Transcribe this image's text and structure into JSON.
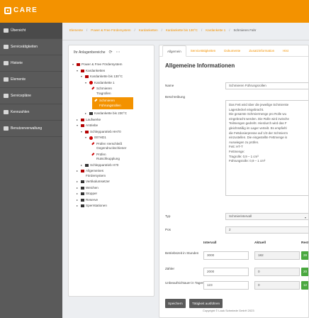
{
  "app": {
    "logo_text": "CARE"
  },
  "sidebar": {
    "items": [
      {
        "label": "Übersicht",
        "icon": "home-icon"
      },
      {
        "label": "Serviceätigkeiten",
        "icon": "wrench-icon"
      },
      {
        "label": "Historie",
        "icon": "history-icon"
      },
      {
        "label": "Elemente",
        "icon": "layers-icon"
      },
      {
        "label": "Servicepläne",
        "icon": "calendar-icon"
      },
      {
        "label": "Kennzahlen",
        "icon": "chart-icon"
      },
      {
        "label": "Benutzerverwaltung",
        "icon": "users-icon"
      }
    ]
  },
  "breadcrumb": [
    "Elemente",
    "Power & Free Fördersystem",
    "Kardanketten",
    "Kardankette bis 130°C",
    "Kardankette 1",
    "Schmieren Fahr"
  ],
  "tree": {
    "header": "Ihr Anlagenbereiche",
    "refresh_icon": "refresh-icon",
    "more_icon": "more-icon",
    "nodes": [
      "Power & Free Fördersystem",
      "Kardanketten",
      "Kardankette bis 130°C",
      "Kardankette 1",
      "Schmieren Tragrollen",
      "Schmieren Führungsrollen",
      "Kardankette bis 230°C",
      "Laufwerke",
      "Antriebe",
      "Schleppantrieb HH70",
      "007HD1",
      "Prüfen Verschleiß Gegendruckschiener",
      "Prüfen Rutschkupplung",
      "Schleppantrieb H70",
      "Allgemeines Fördersystem",
      "Vertikalumsetzer",
      "Weichen",
      "Stopper",
      "Reserve",
      "Sperrstationen"
    ]
  },
  "tabs": [
    "Allgemein",
    "Servicetätigkeiten",
    "Dokumente",
    "Zusatzinformation",
    "Hist"
  ],
  "panel": {
    "title": "Allgemeine Informationen",
    "name_label": "Name",
    "name_value": "Schmieren Führungsrollen",
    "desc_label": "Beschreibung",
    "desc_lines": [
      "Das Fett wird über die jeweilige Schmierste",
      "Lagerdeckel eingebracht.",
      "Die gesamte Schmiermenge pro Rolle wu",
      "eingebracht werden. Die Rolle wird zwische",
      "Teilmengen gedreht. Hierdurch wird das F",
      "gleichmäßig im Lager verteilt. Es empfiehl",
      "die Fettdosierpresse auf 1/3 der Schmierm",
      "einzustellen. Die eingestellte Fettmenge is",
      "Auswiegen zu prüfen.",
      "Fett: HT-T",
      "Fettmenge:",
      "Tragrolle: 0,9 – 1 cm³",
      "Führungsrolle: 0,9 – 1 cm³"
    ],
    "type_label": "Typ",
    "type_value": "Schmierintervall",
    "pos_label": "Pos",
    "pos_value": "2"
  },
  "interval_table": {
    "headers": [
      "Intervall",
      "Aktuell",
      "Rest"
    ],
    "rows": [
      {
        "label": "Betriebszeit in Stunden",
        "interval": "3000",
        "current": "182",
        "rest": "28"
      },
      {
        "label": "Zähler",
        "interval": "2000",
        "current": "0",
        "rest": "20"
      },
      {
        "label": "Unbeaufsichtauer in Tagen",
        "interval": "123",
        "current": "0",
        "rest": "12"
      }
    ]
  },
  "buttons": {
    "save": "Speichern",
    "execute": "Tätigkeit ausführen"
  },
  "footer": "Copyright © Lauk Schmiede GmbH 2023"
}
